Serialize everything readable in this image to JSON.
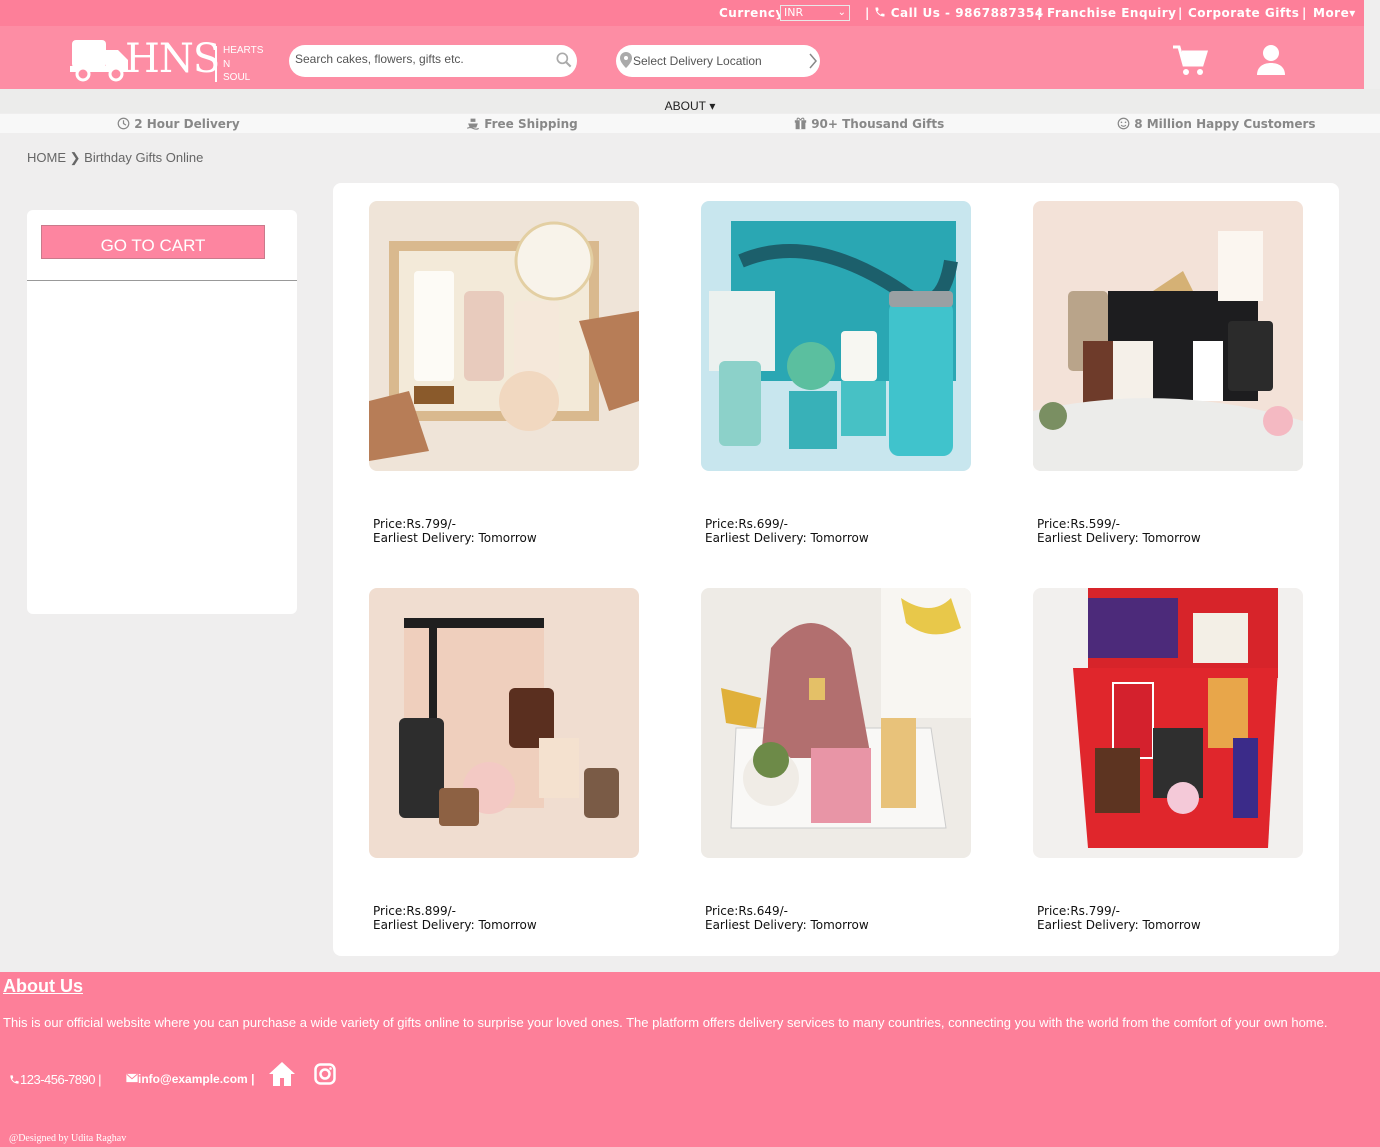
{
  "topbar": {
    "currency_label": "Currency",
    "currency_value": "INR",
    "call": "Call Us - 9867887354",
    "franchise": "Franchise Enquiry",
    "corporate": "Corporate Gifts",
    "more": "More"
  },
  "header": {
    "logo_text": "HNS",
    "logo_sub_1": "HEARTS",
    "logo_sub_2": "N",
    "logo_sub_3": "SOUL",
    "search_placeholder": "Search cakes, flowers, gifts etc.",
    "location_placeholder": "Select Delivery Location"
  },
  "nav": {
    "about": "ABOUT"
  },
  "features": [
    "2 Hour Delivery",
    "Free Shipping",
    "90+ Thousand Gifts",
    "8 Million Happy Customers"
  ],
  "breadcrumb": {
    "home": "HOME",
    "current": "Birthday Gifts Online"
  },
  "sidebar": {
    "cart_button": "GO TO CART"
  },
  "products": [
    {
      "price": "Price:Rs.799/-",
      "delivery": "Earliest Delivery: Tomorrow"
    },
    {
      "price": "Price:Rs.699/-",
      "delivery": "Earliest Delivery: Tomorrow"
    },
    {
      "price": "Price:Rs.599/-",
      "delivery": "Earliest Delivery: Tomorrow"
    },
    {
      "price": "Price:Rs.899/-",
      "delivery": "Earliest Delivery: Tomorrow"
    },
    {
      "price": "Price:Rs.649/-",
      "delivery": "Earliest Delivery: Tomorrow"
    },
    {
      "price": "Price:Rs.799/-",
      "delivery": "Earliest Delivery: Tomorrow"
    }
  ],
  "footer": {
    "title": "About Us",
    "text": "This is our official website where you can purchase a wide variety of gifts online to surprise your loved ones. The platform offers delivery services to many countries, connecting you with the world from the comfort of your own home.",
    "phone": "123-456-7890",
    "email": "info@example.com",
    "credit": "@Designed by Udita Raghav"
  },
  "colors": {
    "brand_pink": "#fd7f99",
    "header_pink": "#fd8da4",
    "button_pink": "#fd85a0"
  }
}
